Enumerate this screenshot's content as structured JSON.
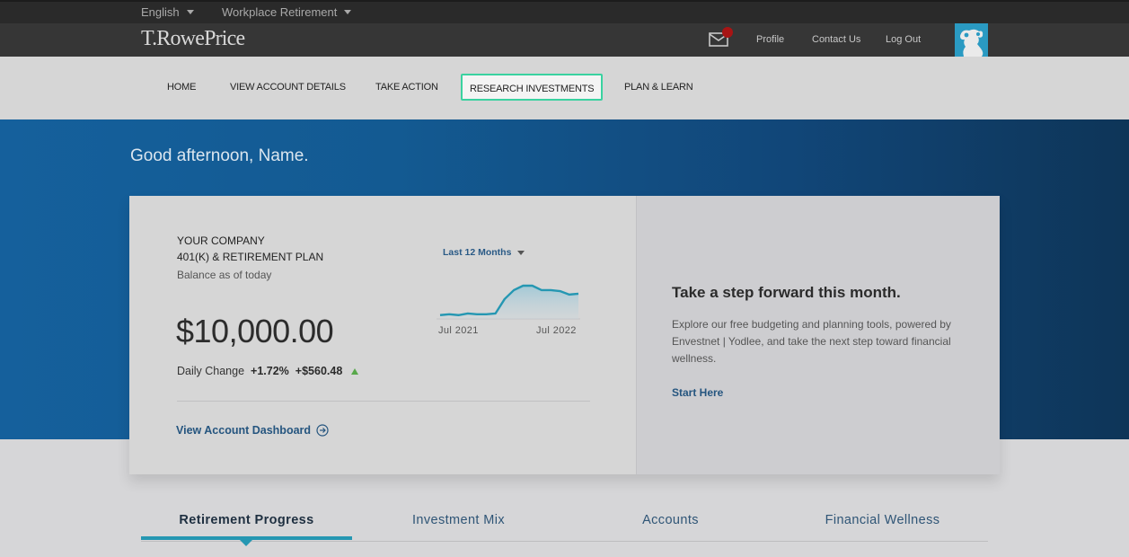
{
  "utility_bar": {
    "language": "English",
    "site": "Workplace Retirement"
  },
  "header": {
    "logo": "T.RowePrice",
    "links": [
      "Profile",
      "Contact Us",
      "Log Out"
    ],
    "mail_icon": "envelope-icon",
    "notification_color": "#a81414",
    "brand_color": "#2a9ac2"
  },
  "nav": {
    "items": [
      {
        "label": "HOME",
        "active": false
      },
      {
        "label": "VIEW ACCOUNT DETAILS",
        "active": false
      },
      {
        "label": "TAKE ACTION",
        "active": false
      },
      {
        "label": "RESEARCH INVESTMENTS",
        "active": true
      },
      {
        "label": "PLAN & LEARN",
        "active": false
      }
    ],
    "highlight_color": "#3ad2a0"
  },
  "hero": {
    "greeting": "Good afternoon, Name."
  },
  "account": {
    "company": "YOUR COMPANY",
    "plan": "401(K) & RETIREMENT PLAN",
    "balance_label": "Balance as of today",
    "balance": "$10,000.00",
    "daily_change_label": "Daily Change",
    "daily_change_pct": "+1.72%",
    "daily_change_amt": "+$560.48",
    "trend": "up",
    "dashboard_link": "View Account Dashboard",
    "period": "Last 12 Months",
    "chart": {
      "x_labels": [
        "Jul 2021",
        "Jul 2022"
      ],
      "values": [
        1.0,
        1.4,
        1.0,
        1.8,
        1.4,
        1.4,
        1.8,
        9.0,
        13.4,
        15.6,
        15.6,
        13.4,
        13.4,
        12.9,
        11.2,
        11.6
      ],
      "line_color": "#2597b2"
    }
  },
  "promo": {
    "title": "Take a step forward this month.",
    "text": "Explore our free budgeting and planning tools, powered by Envestnet | Yodlee, and take the next step toward financial wellness.",
    "link": "Start Here"
  },
  "tabs": [
    {
      "label": "Retirement Progress",
      "active": true
    },
    {
      "label": "Investment Mix",
      "active": false
    },
    {
      "label": "Accounts",
      "active": false
    },
    {
      "label": "Financial Wellness",
      "active": false
    }
  ]
}
